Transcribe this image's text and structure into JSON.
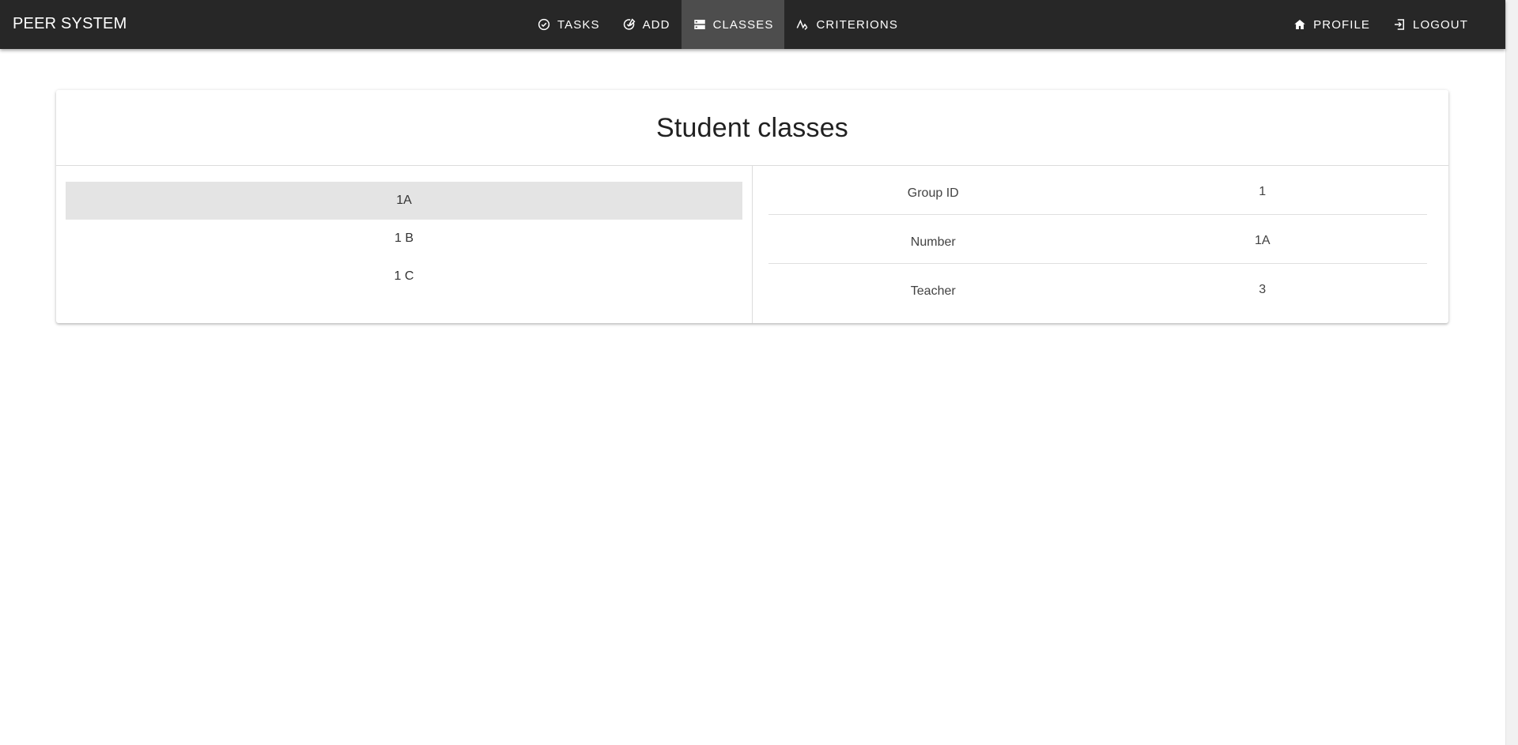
{
  "app": {
    "title": "PEER SYSTEM"
  },
  "nav": {
    "center": [
      {
        "label": "TASKS",
        "icon": "check-circle-icon",
        "active": false
      },
      {
        "label": "ADD",
        "icon": "add-edit-icon",
        "active": false
      },
      {
        "label": "CLASSES",
        "icon": "storage-icon",
        "active": true
      },
      {
        "label": "CRITERIONS",
        "icon": "chart-line-icon",
        "active": false
      }
    ],
    "right": [
      {
        "label": "PROFILE",
        "icon": "home-icon"
      },
      {
        "label": "LOGOUT",
        "icon": "logout-icon"
      }
    ]
  },
  "card": {
    "title": "Student classes"
  },
  "classes": {
    "items": [
      "1A",
      "1 B",
      "1 C"
    ],
    "selected": "1A"
  },
  "details": {
    "rows": [
      {
        "label": "Group ID",
        "value": "1"
      },
      {
        "label": "Number",
        "value": "1A"
      },
      {
        "label": "Teacher",
        "value": "3"
      }
    ]
  },
  "colors": {
    "appbar": "#272727",
    "active_nav": "#4d4d4d",
    "selected_row": "#e4e4e4"
  }
}
